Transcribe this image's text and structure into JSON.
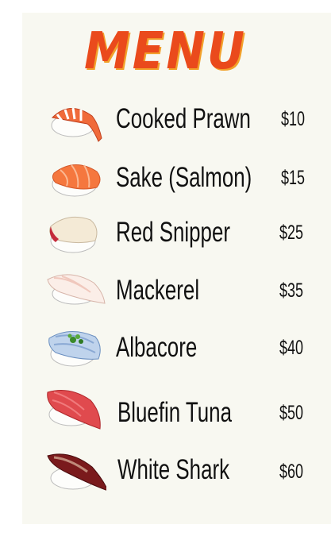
{
  "menu": {
    "title": "MENU",
    "items": [
      {
        "name": "Cooked Prawn",
        "price": "$10",
        "icon": "prawn-nigiri-icon"
      },
      {
        "name": "Sake (Salmon)",
        "price": "$15",
        "icon": "salmon-nigiri-icon"
      },
      {
        "name": "Red Snipper",
        "price": "$25",
        "icon": "red-snapper-nigiri-icon"
      },
      {
        "name": "Mackerel",
        "price": "$35",
        "icon": "mackerel-nigiri-icon"
      },
      {
        "name": "Albacore",
        "price": "$40",
        "icon": "albacore-nigiri-icon"
      },
      {
        "name": "Bluefin Tuna",
        "price": "$50",
        "icon": "bluefin-tuna-nigiri-icon"
      },
      {
        "name": "White Shark",
        "price": "$60",
        "icon": "white-shark-nigiri-icon"
      }
    ]
  },
  "colors": {
    "title": "#ea4a1c",
    "title_shadow": "#f2a12a",
    "panel": "#f8f8f1"
  }
}
